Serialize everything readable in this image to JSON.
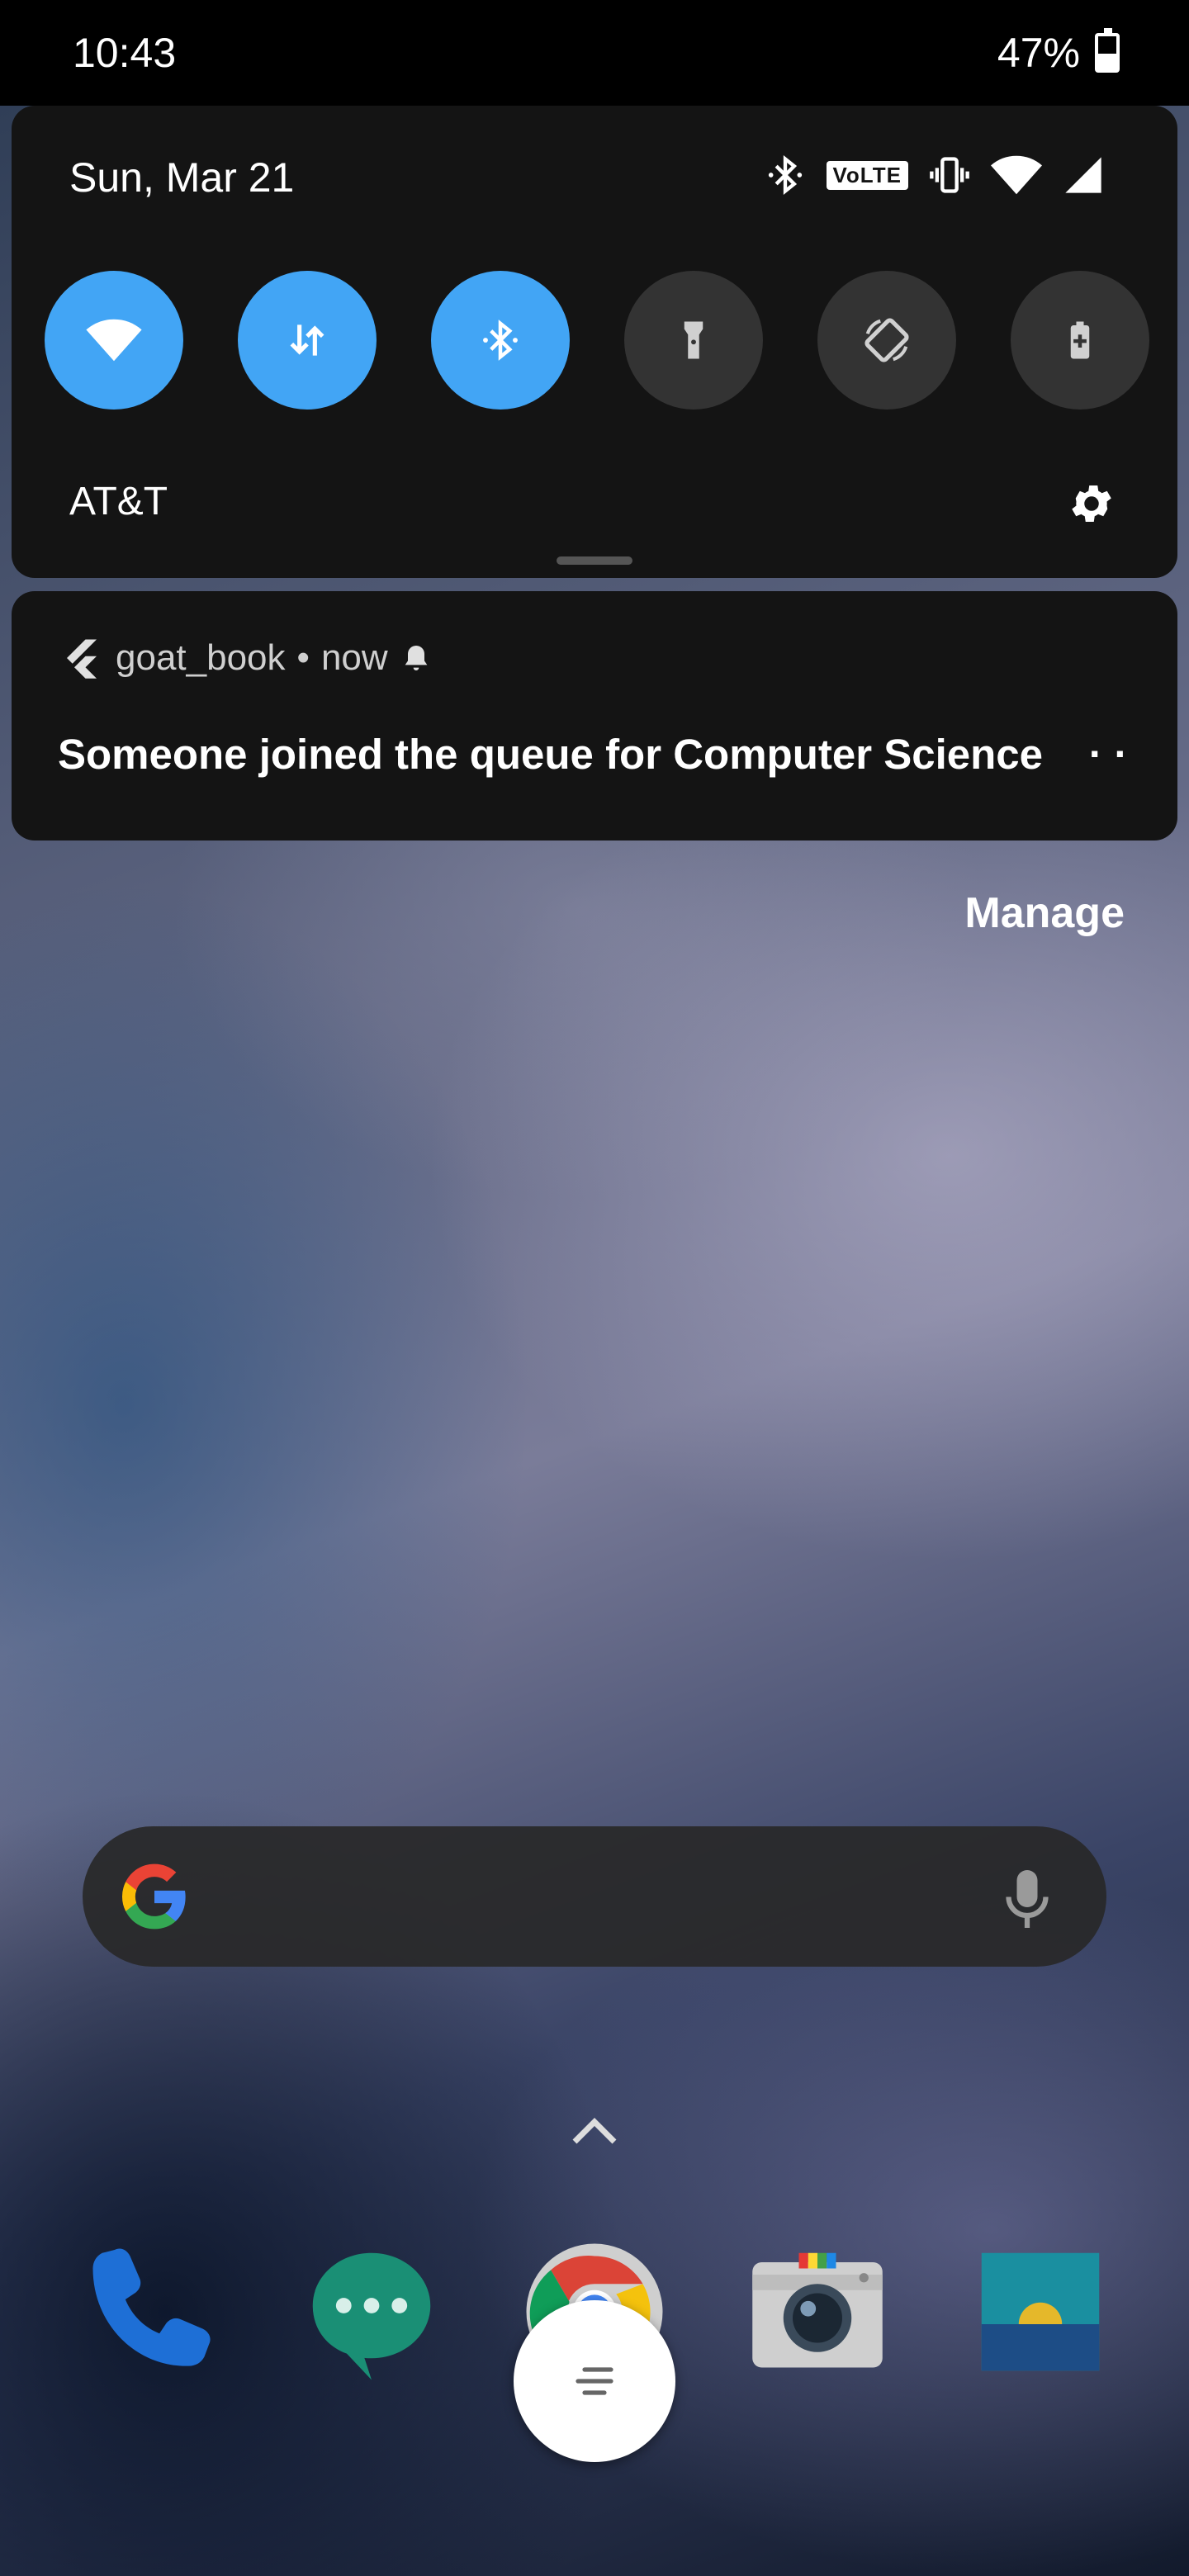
{
  "status_bar": {
    "time": "10:43",
    "battery_percent": "47%",
    "battery_level": 0.47
  },
  "quick_settings": {
    "date": "Sun, Mar 21",
    "status_icons": [
      "bluetooth-icon",
      "volte-badge",
      "vibrate-icon",
      "wifi-icon",
      "cell-signal-icon"
    ],
    "volte_label": "VoLTE",
    "tiles": [
      {
        "name": "wifi",
        "active": true
      },
      {
        "name": "mobile-data",
        "active": true
      },
      {
        "name": "bluetooth",
        "active": true
      },
      {
        "name": "flashlight",
        "active": false
      },
      {
        "name": "auto-rotate",
        "active": false
      },
      {
        "name": "battery-saver",
        "active": false
      }
    ],
    "carrier": "AT&T",
    "accent_color": "#42a5f5"
  },
  "notification": {
    "app_name": "goat_book",
    "separator": "•",
    "time": "now",
    "title": "Someone joined the queue for Computer Science",
    "more": "· ·"
  },
  "manage_label": "Manage",
  "search": {
    "placeholder": ""
  },
  "dock": {
    "apps": [
      "phone",
      "messages",
      "chrome",
      "camera",
      "gallery"
    ]
  }
}
